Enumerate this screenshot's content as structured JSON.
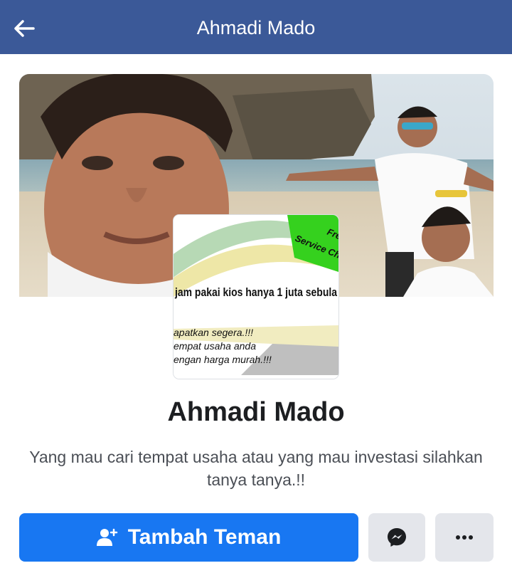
{
  "header": {
    "title": "Ahmadi Mado",
    "back_icon": "arrow-left-icon"
  },
  "cover": {
    "alt_subject": "beach-photo"
  },
  "profile_picture": {
    "ad_line_main": "jam pakai kios hanya 1 juta sebula",
    "ad_badge_1": "Free",
    "ad_badge_2": "Service Cha",
    "ad_line_1": "apatkan segera.!!!",
    "ad_line_2": "empat usaha anda",
    "ad_line_3": "engan harga murah.!!!"
  },
  "profile": {
    "name": "Ahmadi Mado",
    "bio": "Yang mau cari tempat usaha atau yang mau investasi silahkan tanya tanya.!!"
  },
  "actions": {
    "add_friend_label": "Tambah Teman",
    "add_friend_icon": "add-person-icon",
    "messenger_icon": "messenger-icon",
    "more_icon": "more-dots-icon"
  },
  "colors": {
    "header_bg": "#3b5998",
    "primary_button": "#1877f2",
    "secondary_button": "#e4e6eb"
  }
}
